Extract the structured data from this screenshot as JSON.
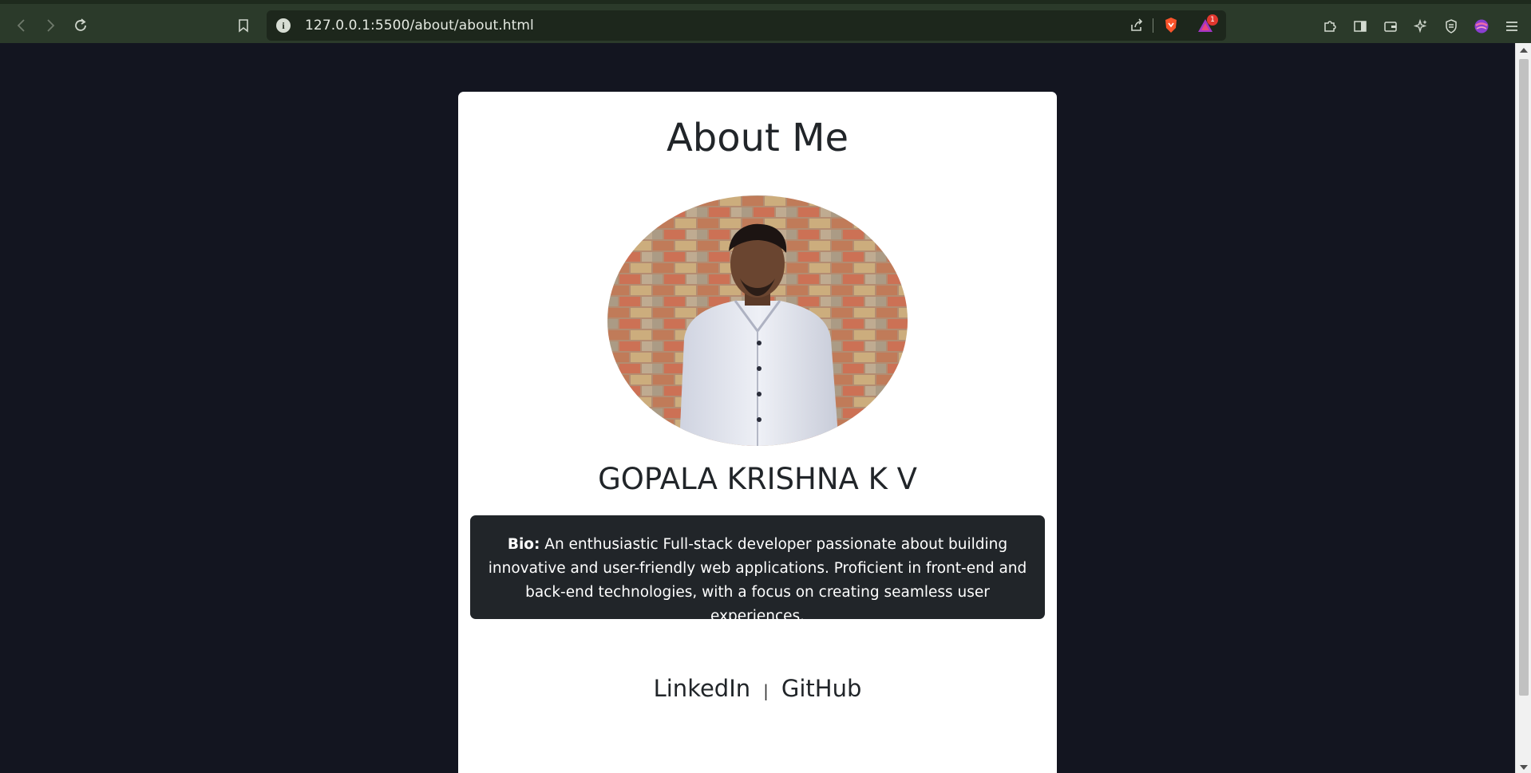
{
  "browser": {
    "url": "127.0.0.1:5500/about/about.html",
    "notification_count": "1"
  },
  "page": {
    "title": "About Me",
    "name": "GOPALA KRISHNA K V",
    "bio_label": "Bio:",
    "bio_text": " An enthusiastic Full-stack developer passionate about building innovative and user-friendly web applications. Proficient in front-end and back-end technologies, with a focus on creating seamless user experiences.",
    "links": {
      "linkedin": "LinkedIn",
      "separator": "|",
      "github": "GitHub"
    }
  },
  "colors": {
    "page_background": "#131520",
    "card_background": "#ffffff",
    "bio_background": "#212529",
    "chrome_background": "#2b3a2a"
  },
  "icons": {
    "back": "arrow-left-icon",
    "forward": "arrow-right-icon",
    "reload": "reload-icon",
    "bookmark": "bookmark-icon",
    "site_info": "info-icon",
    "share": "share-icon",
    "brave": "brave-shield-icon",
    "rewards": "rewards-triangle-icon",
    "extensions": "puzzle-icon",
    "sidebar": "sidebar-icon",
    "wallet": "wallet-icon",
    "leo": "sparkle-icon",
    "vpn": "vpn-shield-icon",
    "profile": "profile-avatar-icon",
    "menu": "hamburger-menu-icon"
  }
}
